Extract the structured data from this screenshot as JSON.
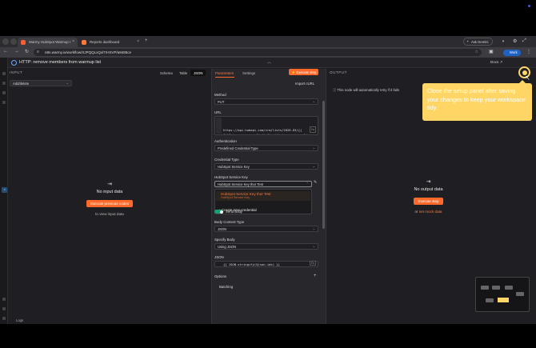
{
  "browser": {
    "tabs": [
      {
        "label": "Warmy HubSpot Warmup I",
        "favicon_color": "#ff5c35"
      },
      {
        "label": "Reports dashboard",
        "favicon_color": "#ff7a3a"
      }
    ],
    "new_tab": "+",
    "ask_gemini": "Ask Gemini",
    "url": "n8n.warmy.io/workflow/XJPQQLxQxl7rHSVP/a9485ce",
    "work_badge": "Work"
  },
  "node": {
    "title": "HTTP: remove members from warmup list",
    "docs_label": "Docs ↗",
    "collapse_glyph": "︽"
  },
  "input": {
    "label": "INPUT",
    "views": [
      "Schema",
      "Table",
      "JSON"
    ],
    "active_view": "JSON",
    "selected_node": "Add/delete",
    "empty_title": "No input data",
    "execute_previous": "Execute previous nodes",
    "hint": "to view input data"
  },
  "params": {
    "tabs": [
      "Parameters",
      "Settings"
    ],
    "execute_step": "⚡ Execute step",
    "import_curl": "Import cURL",
    "method_label": "Method",
    "method_value": "PUT",
    "url_label": "URL",
    "url_value": "https://api.hubapi.com/crm/lists/2026-03/{{\n$('Set: warmup config').first().json.warmup_lis\nt_id }}/memberships/remove",
    "auth_label": "Authentication",
    "auth_value": "Predefined Credential Type",
    "cred_type_label": "Credential Type",
    "cred_type_value": "HubSpot Service Key",
    "service_key_label": "HubSpot Service Key",
    "service_key_value": "HubSpot Service Key thor Test",
    "dropdown_option_title": "HubSpot Service Key thor Test",
    "dropdown_option_sub": "HubSpot Service Key",
    "create_credential": "+ Create new credential",
    "send_body_label": "Send Body",
    "send_body_on": true,
    "body_type_label": "Body Content Type",
    "body_type_value": "JSON",
    "specify_body_label": "Specify Body",
    "specify_body_value": "Using JSON",
    "json_label": "JSON",
    "json_value": "{{ JSON.stringify($json.ids) }}",
    "options_label": "Options",
    "batching_label": "Batching"
  },
  "output": {
    "label": "OUTPUT",
    "retry_note": "This node will automatically retry if it fails",
    "empty_title": "No output data",
    "execute_step": "Execute step",
    "or_text": "or",
    "set_mock": "set mock data"
  },
  "tooltip": {
    "text": "Close the setup panel after saving your changes to keep your workspace tidy.",
    "highlight_color": "#ffd666"
  },
  "footer": {
    "logs": "Logs"
  },
  "colors": {
    "accent": "#ff6a2b",
    "toggle_on": "#19a06c"
  }
}
